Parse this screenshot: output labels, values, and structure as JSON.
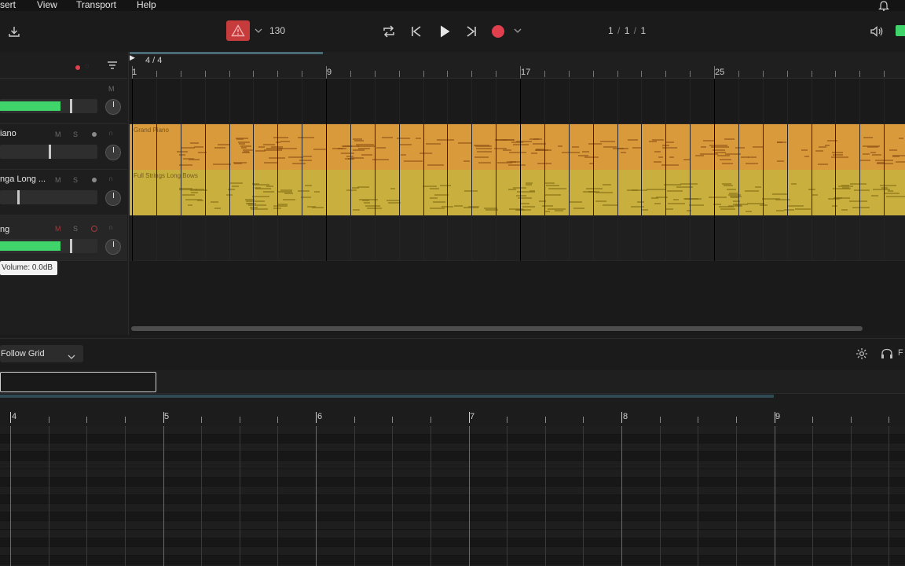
{
  "menu": [
    "sert",
    "View",
    "Transport",
    "Help"
  ],
  "transport": {
    "tempo": "130",
    "position": [
      "1",
      "/",
      "1",
      "/",
      "1"
    ]
  },
  "tracklist": {
    "tracks": [
      {
        "name": "",
        "buttons": [
          "M"
        ],
        "volume_level": 0.62
      },
      {
        "name": "iano",
        "buttons": [
          "M",
          "S"
        ],
        "volume_level": 0.4
      },
      {
        "name": "nga Long ...",
        "buttons": [
          "M",
          "S"
        ],
        "volume_level": 0.08
      },
      {
        "name": "ng",
        "buttons": [
          "M",
          "S"
        ],
        "volume_level": 0.62
      }
    ],
    "tooltip": "Volume: 0.0dB"
  },
  "arrangement": {
    "time_signature": "4 / 4",
    "bar_labels": [
      "1",
      "9",
      "17",
      "25"
    ],
    "clips": [
      {
        "name": "Grand Piano",
        "color": "#d89a3a"
      },
      {
        "name": "Full Strings Long Bows",
        "color": "#c9b03e"
      }
    ]
  },
  "editor": {
    "snap": "Follow Grid",
    "filter_value": "",
    "bar_labels": [
      "4",
      "5",
      "6",
      "7",
      "8",
      "9"
    ],
    "right_label": "F"
  },
  "colors": {
    "accent_green": "#3fd56a",
    "record_red": "#e0404e",
    "warning_red": "#c63b3b"
  }
}
